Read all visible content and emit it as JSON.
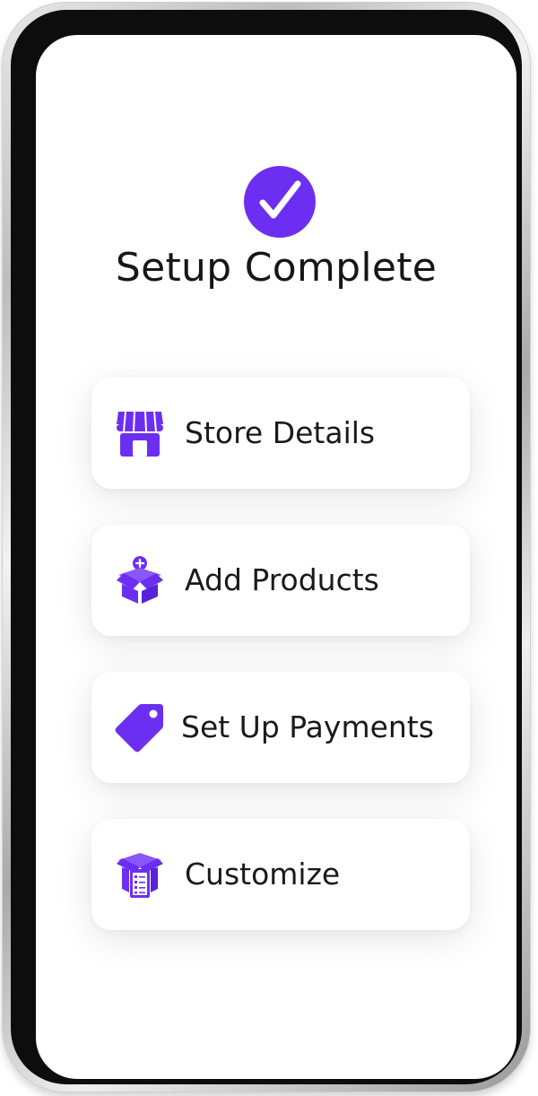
{
  "screen": {
    "title": "Setup Complete",
    "status_icon": "check-circle-icon"
  },
  "steps": [
    {
      "label": "Store Details",
      "icon": "storefront-icon"
    },
    {
      "label": "Add Products",
      "icon": "box-plus-icon"
    },
    {
      "label": "Set Up Payments",
      "icon": "price-tag-icon"
    },
    {
      "label": "Customize",
      "icon": "box-checklist-icon"
    }
  ],
  "colors": {
    "accent": "#6c2ff2",
    "text": "#161616",
    "card_background": "#ffffff"
  }
}
